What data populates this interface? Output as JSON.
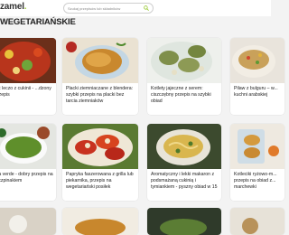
{
  "header": {
    "logo": "zamel",
    "search_placeholder": "Szukaj przepisów lub składników"
  },
  "page": {
    "title": "WEGETARIAŃSKIE"
  },
  "cards": [
    {
      "title": "łeć leczo z cukinii - ...dzony przepis"
    },
    {
      "title": "Placki ziemniaczane z blendera: szybki przepis na placki bez tarcia ziemniaków"
    },
    {
      "title": "Kotlety jajeczne z serem: ciszczębny przepis na szybki obiad"
    },
    {
      "title": "Pilaw z bulguru – w... kuchni arabskiej"
    },
    {
      "title": "...a verde - dobry przepis na ...czpinakiem"
    },
    {
      "title": "Papryka faszerowana z grilla lub piekarnika, przepis na wegetariański posiłek"
    },
    {
      "title": "Aromatyczny i lekki makaron z podsmażaną cukinią i tymiankiem - pyszny obiad w 15"
    },
    {
      "title": "Kotleciki ryżowo-m... przepis na obiad z... marchewki"
    }
  ],
  "colors": {
    "accent": "#9ccb3c",
    "background": "#f3f3f3"
  }
}
